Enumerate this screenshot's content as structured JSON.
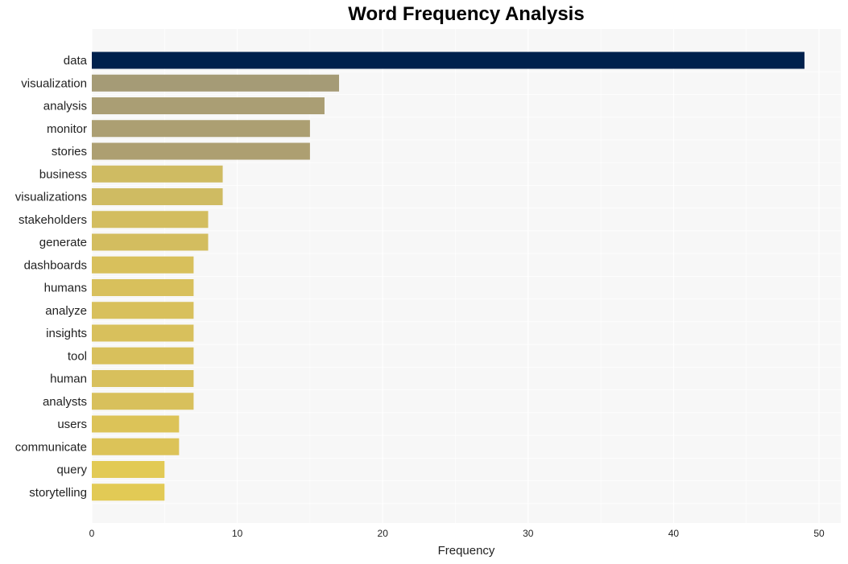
{
  "chart_data": {
    "type": "bar",
    "orientation": "horizontal",
    "title": "Word Frequency Analysis",
    "xlabel": "Frequency",
    "ylabel": "",
    "xlim": [
      0,
      51.5
    ],
    "xticks": [
      0,
      10,
      20,
      30,
      40,
      50
    ],
    "grid": true,
    "categories": [
      "data",
      "visualization",
      "analysis",
      "monitor",
      "stories",
      "business",
      "visualizations",
      "stakeholders",
      "generate",
      "dashboards",
      "humans",
      "analyze",
      "insights",
      "tool",
      "human",
      "analysts",
      "users",
      "communicate",
      "query",
      "storytelling"
    ],
    "values": [
      49,
      17,
      16,
      15,
      15,
      9,
      9,
      8,
      8,
      7,
      7,
      7,
      7,
      7,
      7,
      7,
      6,
      6,
      5,
      5
    ],
    "colors": [
      "#00214d",
      "#a59b76",
      "#aa9e74",
      "#ac9f72",
      "#ad9f71",
      "#cfbb62",
      "#cfbb62",
      "#d3bd5f",
      "#d3bd5f",
      "#d8c05c",
      "#d8c05c",
      "#d8c05c",
      "#d8c05c",
      "#d8c05c",
      "#d8c05c",
      "#d8c05c",
      "#dcc358",
      "#dcc358",
      "#e2ca55",
      "#e2ca55"
    ]
  }
}
